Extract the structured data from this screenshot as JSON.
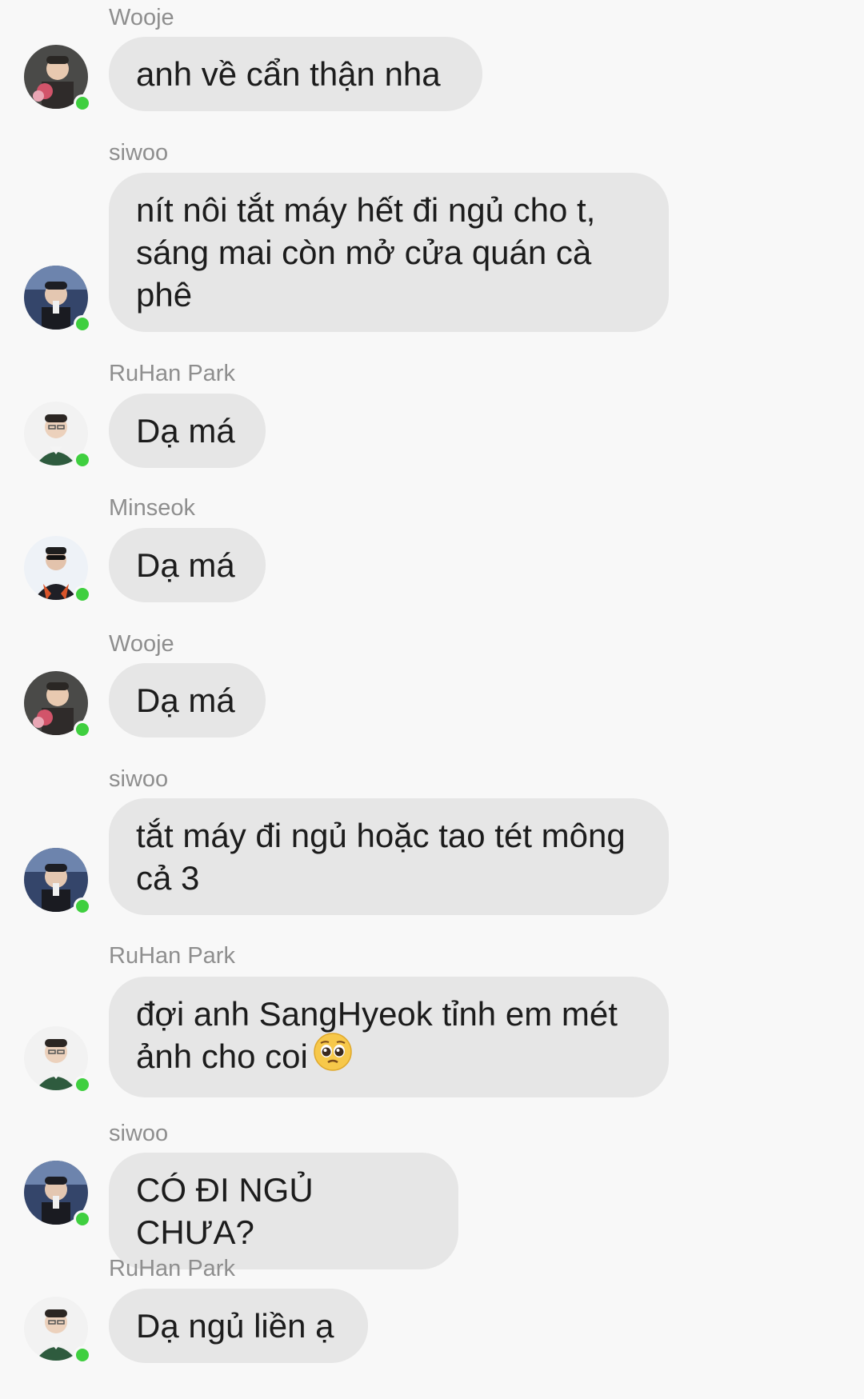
{
  "messages": [
    {
      "sender": "Wooje",
      "avatar": "avatar-wooje",
      "text": "anh về cẩn thận nha"
    },
    {
      "sender": "siwoo",
      "avatar": "avatar-siwoo",
      "text": "nít nôi tắt máy hết đi ngủ cho t, sáng mai còn mở cửa quán cà phê"
    },
    {
      "sender": "RuHan Park",
      "avatar": "avatar-ruhan",
      "text": "Dạ má"
    },
    {
      "sender": "Minseok",
      "avatar": "avatar-minseok",
      "text": "Dạ má"
    },
    {
      "sender": "Wooje",
      "avatar": "avatar-wooje",
      "text": "Dạ má"
    },
    {
      "sender": "siwoo",
      "avatar": "avatar-siwoo",
      "text": "tắt máy đi ngủ hoặc tao tét mông cả 3"
    },
    {
      "sender": "RuHan Park",
      "avatar": "avatar-ruhan",
      "text": "đợi anh SangHyeok tỉnh em mét ảnh cho coi",
      "emoji": "pleading-face-emoji"
    },
    {
      "sender": "siwoo",
      "avatar": "avatar-siwoo",
      "text": "CÓ ĐI NGỦ CHƯA?"
    },
    {
      "sender": "RuHan Park",
      "avatar": "avatar-ruhan",
      "text": "Dạ ngủ liền ạ"
    }
  ],
  "colors": {
    "background": "#f8f8f8",
    "bubble": "#e6e6e6",
    "sender_name": "#8e8e8e",
    "online_indicator": "#3fcf3f"
  }
}
